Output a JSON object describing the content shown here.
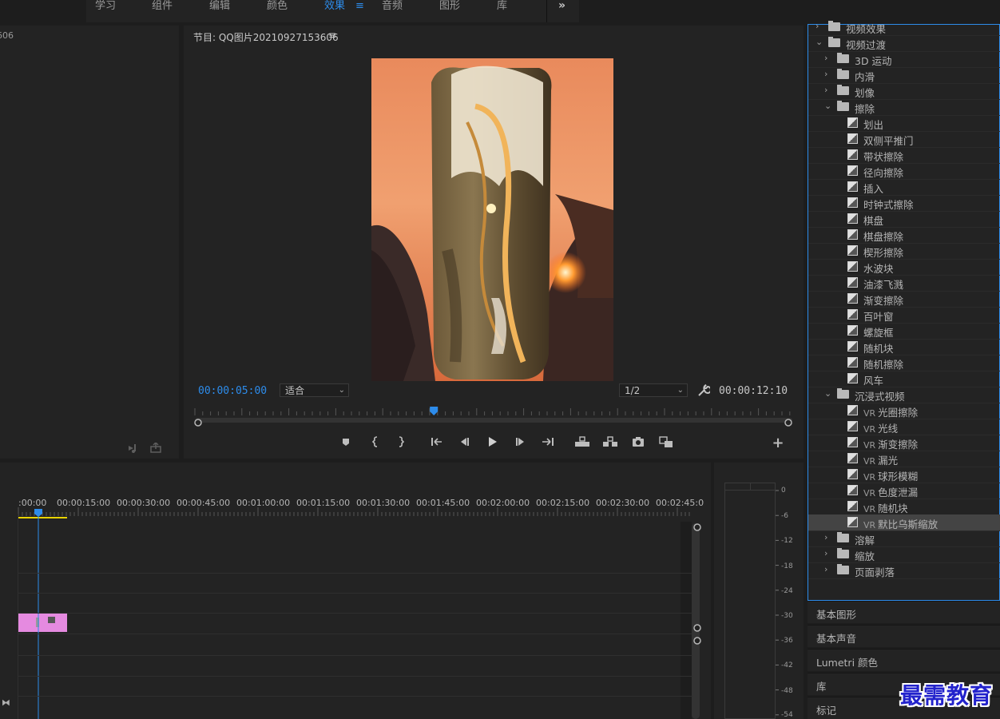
{
  "workspaces": [
    "学习",
    "组件",
    "编辑",
    "颜色",
    "效果",
    "音频",
    "图形",
    "库"
  ],
  "workspace_active": "效果",
  "workspace_menu_icon": "≡",
  "more_icon": "»",
  "source_panel": {
    "tab_fragment": "606"
  },
  "program": {
    "title": "节目: QQ图片20210927153606",
    "menu_icon": "≡",
    "current_tc": "00:00:05:00",
    "fit_select": "适合",
    "resolution_select": "1/2",
    "duration_tc": "00:00:12:10",
    "playhead_fraction": 0.4
  },
  "effects": {
    "rows": [
      {
        "level": 0,
        "type": "folder",
        "expanded": false,
        "label": "视频效果"
      },
      {
        "level": 0,
        "type": "folder",
        "expanded": true,
        "label": "视频过渡"
      },
      {
        "level": 1,
        "type": "folder",
        "expanded": false,
        "label": "3D 运动"
      },
      {
        "level": 1,
        "type": "folder",
        "expanded": false,
        "label": "内滑"
      },
      {
        "level": 1,
        "type": "folder",
        "expanded": false,
        "label": "划像"
      },
      {
        "level": 1,
        "type": "folder",
        "expanded": true,
        "label": "擦除"
      },
      {
        "level": 2,
        "type": "item",
        "label": "划出"
      },
      {
        "level": 2,
        "type": "item",
        "label": "双侧平推门"
      },
      {
        "level": 2,
        "type": "item",
        "label": "带状擦除"
      },
      {
        "level": 2,
        "type": "item",
        "label": "径向擦除"
      },
      {
        "level": 2,
        "type": "item",
        "label": "插入"
      },
      {
        "level": 2,
        "type": "item",
        "label": "时钟式擦除"
      },
      {
        "level": 2,
        "type": "item",
        "label": "棋盘"
      },
      {
        "level": 2,
        "type": "item",
        "label": "棋盘擦除"
      },
      {
        "level": 2,
        "type": "item",
        "label": "楔形擦除"
      },
      {
        "level": 2,
        "type": "item",
        "label": "水波块"
      },
      {
        "level": 2,
        "type": "item",
        "label": "油漆飞溅"
      },
      {
        "level": 2,
        "type": "item",
        "label": "渐变擦除"
      },
      {
        "level": 2,
        "type": "item",
        "label": "百叶窗"
      },
      {
        "level": 2,
        "type": "item",
        "label": "螺旋框"
      },
      {
        "level": 2,
        "type": "item",
        "label": "随机块"
      },
      {
        "level": 2,
        "type": "item",
        "label": "随机擦除"
      },
      {
        "level": 2,
        "type": "item",
        "label": "风车"
      },
      {
        "level": 1,
        "type": "folder",
        "expanded": true,
        "label": "沉浸式视频"
      },
      {
        "level": 2,
        "type": "item",
        "vr": "VR",
        "label": "光圈擦除"
      },
      {
        "level": 2,
        "type": "item",
        "vr": "VR",
        "label": "光线"
      },
      {
        "level": 2,
        "type": "item",
        "vr": "VR",
        "label": "渐变擦除"
      },
      {
        "level": 2,
        "type": "item",
        "vr": "VR",
        "label": "漏光"
      },
      {
        "level": 2,
        "type": "item",
        "vr": "VR",
        "label": "球形模糊"
      },
      {
        "level": 2,
        "type": "item",
        "vr": "VR",
        "label": "色度泄漏"
      },
      {
        "level": 2,
        "type": "item",
        "vr": "VR",
        "label": "随机块"
      },
      {
        "level": 2,
        "type": "item",
        "vr": "VR",
        "label": "默比乌斯缩放",
        "selected": true
      },
      {
        "level": 1,
        "type": "folder",
        "expanded": false,
        "label": "溶解"
      },
      {
        "level": 1,
        "type": "folder",
        "expanded": false,
        "label": "缩放"
      },
      {
        "level": 1,
        "type": "folder",
        "expanded": false,
        "label": "页面剥落"
      }
    ]
  },
  "side_panels": [
    "基本图形",
    "基本声音",
    "Lumetri 颜色",
    "库",
    "标记"
  ],
  "timeline": {
    "ticks": [
      ":00:00",
      "00:00:15:00",
      "00:00:30:00",
      "00:00:45:00",
      "00:01:00:00",
      "00:01:15:00",
      "00:01:30:00",
      "00:01:45:00",
      "00:02:00:00",
      "00:02:15:00",
      "00:02:30:00",
      "00:02:45:0"
    ],
    "clip_badge": "fx"
  },
  "meter": {
    "db_labels": [
      "0",
      "-6",
      "-12",
      "-18",
      "-24",
      "-30",
      "-36",
      "-42",
      "-48",
      "-54"
    ]
  },
  "watermark": "最需教育",
  "colors": {
    "accent": "#2d8ceb",
    "panel": "#232323",
    "bg": "#1d1d1d",
    "clip": "#e58ae0",
    "in_out": "#e8d300"
  }
}
